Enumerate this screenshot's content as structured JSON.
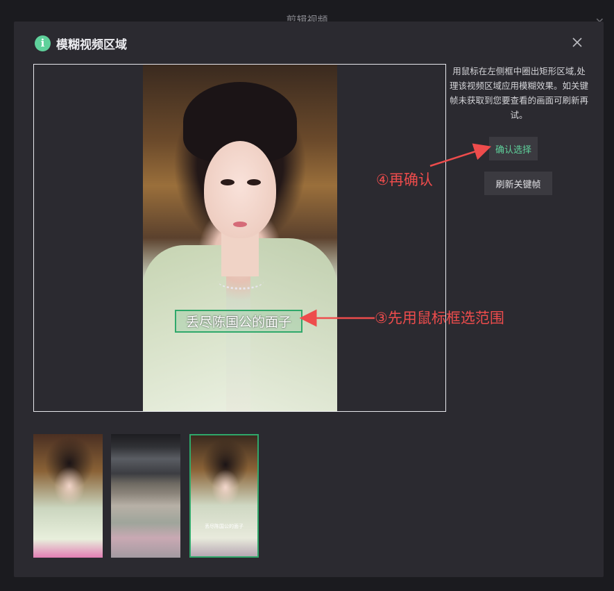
{
  "background_title": "剪辑视频",
  "dialog": {
    "title": "模糊视频区域",
    "instructions": "用鼠标在左侧框中圈出矩形区域,处理该视频区域应用模糊效果。如关键帧未获取到您要查看的画面可刷新再试。",
    "confirm_label": "确认选择",
    "refresh_label": "刷新关键帧"
  },
  "preview": {
    "subtitle_text": "丢尽陈国公的面子"
  },
  "annotations": {
    "step4": "④再确认",
    "step3": "③先用鼠标框选范围"
  },
  "thumbnails": [
    {
      "subtitle": ""
    },
    {
      "subtitle": ""
    },
    {
      "subtitle": "丢尽陈国公的面子"
    }
  ],
  "colors": {
    "accent": "#5fd19b",
    "annotation": "#ee4c4c",
    "selection": "#2fa86a"
  }
}
